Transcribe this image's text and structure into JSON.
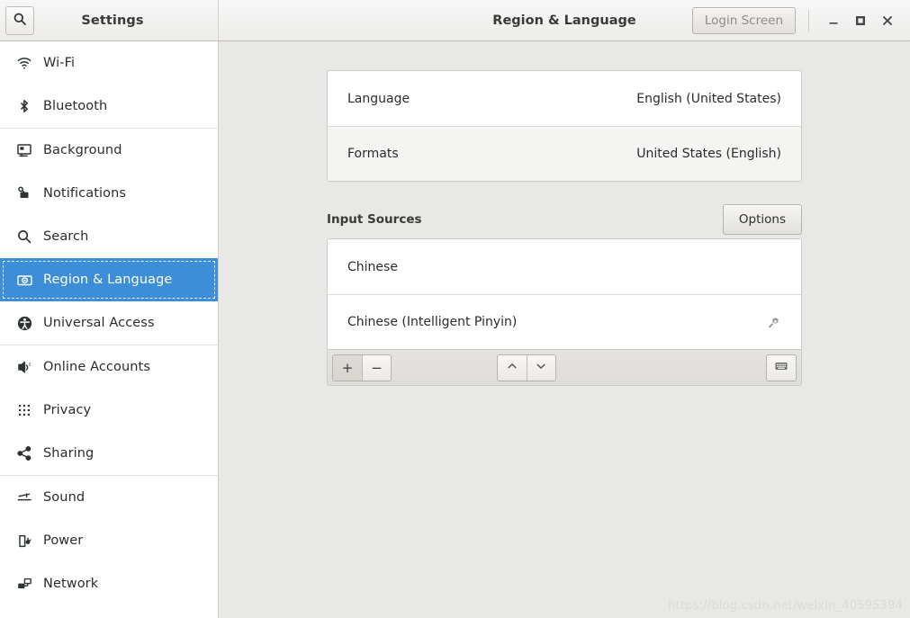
{
  "header": {
    "search_icon": "search-icon",
    "sidebar_title": "Settings",
    "title": "Region & Language",
    "login_screen_label": "Login Screen",
    "minimize_icon": "minimize-icon",
    "maximize_icon": "maximize-icon",
    "close_icon": "close-icon"
  },
  "sidebar": {
    "items": [
      {
        "label": "Wi-Fi",
        "icon": "wifi-icon",
        "selected": false,
        "sep_after": false
      },
      {
        "label": "Bluetooth",
        "icon": "bluetooth-icon",
        "selected": false,
        "sep_after": true
      },
      {
        "label": "Background",
        "icon": "background-icon",
        "selected": false,
        "sep_after": false
      },
      {
        "label": "Notifications",
        "icon": "notifications-icon",
        "selected": false,
        "sep_after": false
      },
      {
        "label": "Search",
        "icon": "search-icon",
        "selected": false,
        "sep_after": false
      },
      {
        "label": "Region & Language",
        "icon": "region-language-icon",
        "selected": true,
        "sep_after": false
      },
      {
        "label": "Universal Access",
        "icon": "universal-access-icon",
        "selected": false,
        "sep_after": true
      },
      {
        "label": "Online Accounts",
        "icon": "online-accounts-icon",
        "selected": false,
        "sep_after": false
      },
      {
        "label": "Privacy",
        "icon": "privacy-icon",
        "selected": false,
        "sep_after": false
      },
      {
        "label": "Sharing",
        "icon": "sharing-icon",
        "selected": false,
        "sep_after": true
      },
      {
        "label": "Sound",
        "icon": "sound-icon",
        "selected": false,
        "sep_after": false
      },
      {
        "label": "Power",
        "icon": "power-icon",
        "selected": false,
        "sep_after": false
      },
      {
        "label": "Network",
        "icon": "network-icon",
        "selected": false,
        "sep_after": false
      }
    ]
  },
  "main": {
    "language_rows": [
      {
        "key": "Language",
        "value": "English (United States)"
      },
      {
        "key": "Formats",
        "value": "United States (English)"
      }
    ],
    "input_sources": {
      "title": "Input Sources",
      "options_label": "Options",
      "rows": [
        {
          "label": "Chinese",
          "has_gear": false
        },
        {
          "label": "Chinese (Intelligent Pinyin)",
          "has_gear": true,
          "gear_icon": "preferences-gear-icon"
        }
      ],
      "toolbar": {
        "add_label": "+",
        "remove_label": "−",
        "move_up_icon": "chevron-up-icon",
        "move_down_icon": "chevron-down-icon",
        "keyboard_icon": "keyboard-icon"
      }
    }
  },
  "watermark": "https://blog.csdn.net/weixin_40595394",
  "colors": {
    "accent": "#3c8ed8",
    "content_bg": "#e8e8e6",
    "sidebar_bg": "#ffffff"
  }
}
